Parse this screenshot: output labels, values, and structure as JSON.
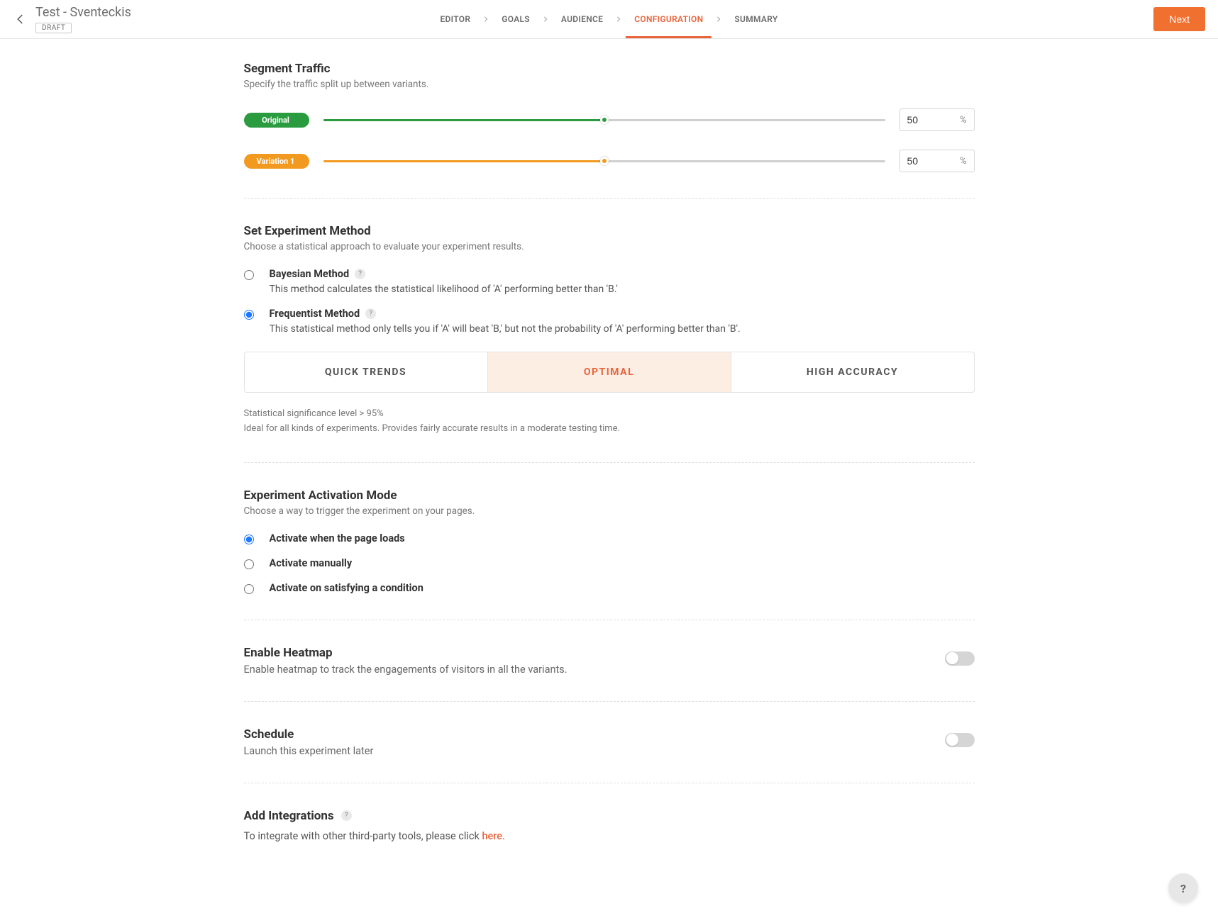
{
  "header": {
    "title": "Test - Sventeckis",
    "badge": "DRAFT",
    "tabs": [
      "EDITOR",
      "GOALS",
      "AUDIENCE",
      "CONFIGURATION",
      "SUMMARY"
    ],
    "active_tab_index": 3,
    "next_button": "Next"
  },
  "segment_traffic": {
    "title": "Segment Traffic",
    "subtitle": "Specify the traffic split up between variants.",
    "variants": [
      {
        "name": "Original",
        "value": "50",
        "percent": 50,
        "color": "green"
      },
      {
        "name": "Variation 1",
        "value": "50",
        "percent": 50,
        "color": "orange"
      }
    ],
    "unit": "%"
  },
  "experiment_method": {
    "title": "Set Experiment Method",
    "subtitle": "Choose a statistical approach to evaluate your experiment results.",
    "options": [
      {
        "label": "Bayesian Method",
        "desc": "This method calculates the statistical likelihood of 'A' performing better than 'B.'",
        "selected": false
      },
      {
        "label": "Frequentist Method",
        "desc": "This statistical method only tells you if 'A' will beat 'B,' but not the probability of 'A' performing better than 'B'.",
        "selected": true
      }
    ],
    "level_tabs": [
      "QUICK TRENDS",
      "OPTIMAL",
      "HIGH ACCURACY"
    ],
    "active_level_index": 1,
    "info_line1": "Statistical significance level > 95%",
    "info_line2": "Ideal for all kinds of experiments. Provides fairly accurate results in a moderate testing time."
  },
  "activation_mode": {
    "title": "Experiment Activation Mode",
    "subtitle": "Choose a way to trigger the experiment on your pages.",
    "options": [
      {
        "label": "Activate when the page loads",
        "selected": true
      },
      {
        "label": "Activate manually",
        "selected": false
      },
      {
        "label": "Activate on satisfying a condition",
        "selected": false
      }
    ]
  },
  "heatmap": {
    "title": "Enable Heatmap",
    "subtitle": "Enable heatmap to track the engagements of visitors in all the variants.",
    "enabled": false
  },
  "schedule": {
    "title": "Schedule",
    "subtitle": "Launch this experiment later",
    "enabled": false
  },
  "integrations": {
    "title": "Add Integrations",
    "text_prefix": "To integrate with other third-party tools, please click ",
    "link_text": "here."
  },
  "help_button": "?"
}
